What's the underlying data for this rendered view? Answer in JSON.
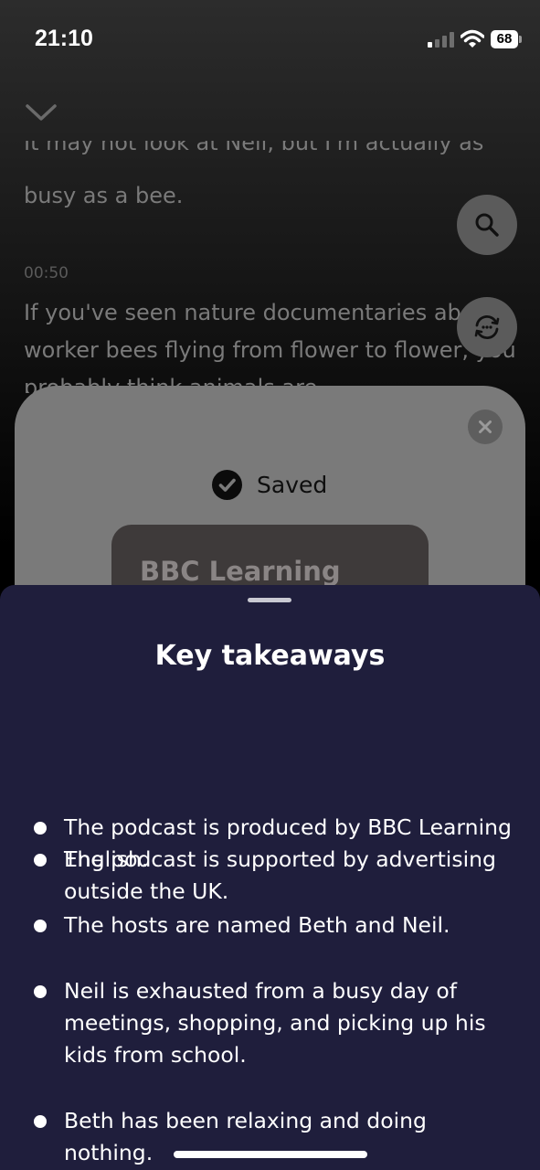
{
  "status_bar": {
    "time": "21:10",
    "battery_level": "68",
    "signal_bars_active": 1,
    "signal_bars_total": 4,
    "icons": [
      "cellular-signal-icon",
      "wifi-icon",
      "battery-icon"
    ]
  },
  "player": {
    "collapse_icon": "chevron-down-icon",
    "transcript": {
      "cut_line": "It may not look at Neil, but I'm actually as",
      "segment_1_end": "busy as a bee.",
      "timestamp": "00:50",
      "segment_2": "If you've seen nature documentaries about worker bees flying from flower to flower, you probably think animals are"
    },
    "search_icon": "search-icon",
    "sync_icon": "sync-transcript-icon"
  },
  "saved_card": {
    "close_icon": "close-icon",
    "check_icon": "check-circle-icon",
    "saved_label": "Saved",
    "podcast_title": "BBC Learning"
  },
  "key_takeaways": {
    "title": "Key takeaways",
    "items": [
      "The podcast is supported by advertising outside the UK.",
      "The podcast is produced by BBC Learning English.",
      "The hosts are named Beth and Neil.",
      "Neil is exhausted from a busy day of meetings, shopping, and picking up his kids from school.",
      "Beth has been relaxing and doing nothing."
    ]
  },
  "colors": {
    "sheet_background": "#1f1e3c",
    "fab_background": "#5b5b5b",
    "card_background": "#7a7a7a"
  }
}
